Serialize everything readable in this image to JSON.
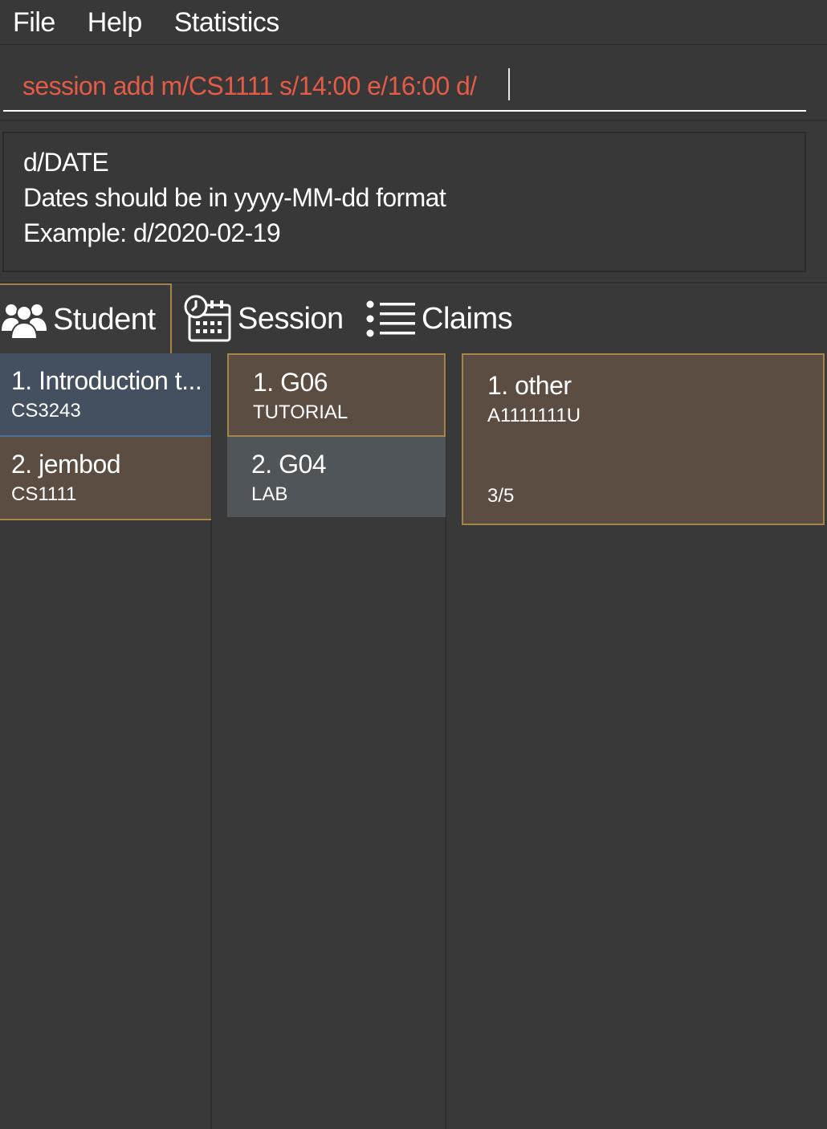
{
  "menu": {
    "file": "File",
    "help": "Help",
    "statistics": "Statistics"
  },
  "command": {
    "value": "session add m/CS1111 s/14:00 e/16:00 d/"
  },
  "result": {
    "lines": [
      "d/DATE",
      "Dates should be in yyyy-MM-dd format",
      "Example: d/2020-02-19"
    ]
  },
  "tabs": [
    {
      "label": "Student",
      "icon": "students-icon"
    },
    {
      "label": "Session",
      "icon": "calendar-clock-icon"
    },
    {
      "label": "Claims",
      "icon": "list-icon"
    }
  ],
  "students": [
    {
      "title": "1.  Introduction t...",
      "code": "CS3243"
    },
    {
      "title": "2.  jembod",
      "code": "CS1111"
    }
  ],
  "sessions": [
    {
      "title": "1.  G06",
      "type": "TUTORIAL"
    },
    {
      "title": "2.  G04",
      "type": "LAB"
    }
  ],
  "claims": [
    {
      "title": "1.  other",
      "id": "A1111111U",
      "progress": "3/5"
    }
  ],
  "colors": {
    "background": "#393939",
    "command_text": "#e45b47",
    "selected_border": "#a5844a",
    "card_brown": "#5c4d42",
    "card_blue": "#44505f",
    "card_gray": "#4f5559"
  }
}
